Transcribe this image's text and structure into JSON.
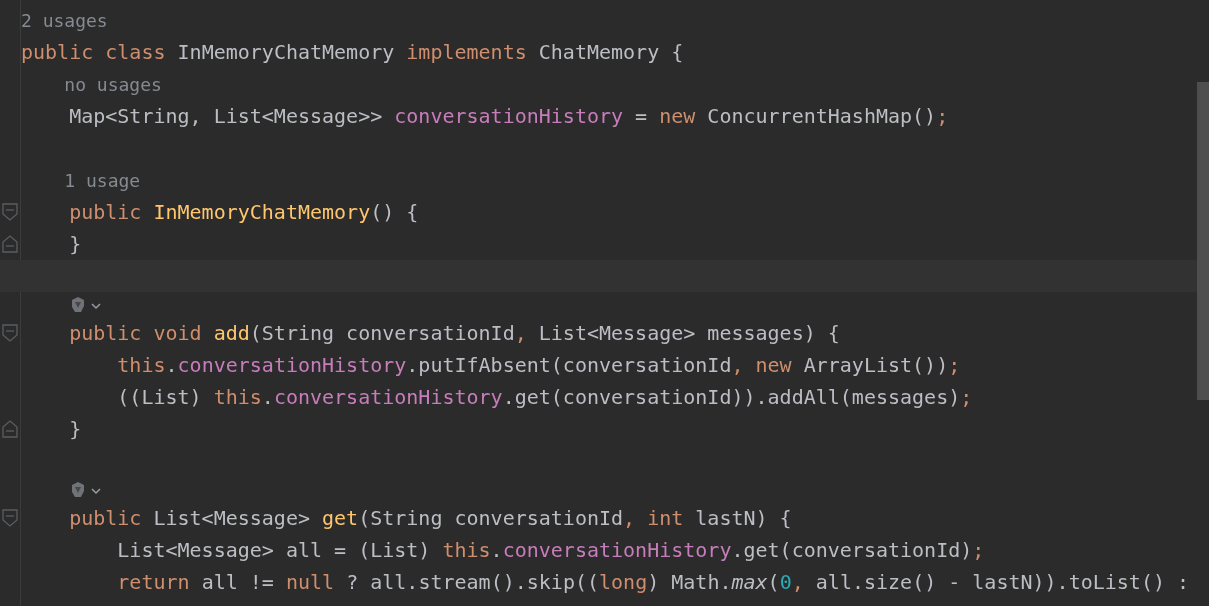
{
  "editor": {
    "lines": [
      {
        "kind": "hint",
        "tokens": [
          {
            "t": "2 usages",
            "kind": "hint"
          }
        ]
      },
      {
        "kind": "code",
        "tokens": [
          {
            "t": "public class ",
            "kind": "kw"
          },
          {
            "t": "InMemoryChatMemory ",
            "kind": "plain"
          },
          {
            "t": "implements ",
            "kind": "kw"
          },
          {
            "t": "ChatMemory {",
            "kind": "plain"
          }
        ]
      },
      {
        "kind": "hint",
        "tokens": [
          {
            "t": "    no usages",
            "kind": "hint"
          }
        ]
      },
      {
        "kind": "code",
        "tokens": [
          {
            "t": "    Map<String, List<Message>> ",
            "kind": "plain"
          },
          {
            "t": "conversationHistory",
            "kind": "field"
          },
          {
            "t": " = ",
            "kind": "plain"
          },
          {
            "t": "new ",
            "kind": "kw"
          },
          {
            "t": "ConcurrentHashMap()",
            "kind": "plain"
          },
          {
            "t": ";",
            "kind": "kw"
          }
        ]
      },
      {
        "kind": "blank"
      },
      {
        "kind": "hint",
        "tokens": [
          {
            "t": "    1 usage",
            "kind": "hint"
          }
        ]
      },
      {
        "kind": "code",
        "fold": {
          "kind": "start"
        },
        "tokens": [
          {
            "t": "    public ",
            "kind": "kw"
          },
          {
            "t": "InMemoryChatMemory",
            "kind": "decl"
          },
          {
            "t": "() {",
            "kind": "plain"
          }
        ]
      },
      {
        "kind": "code",
        "fold": {
          "kind": "end"
        },
        "tokens": [
          {
            "t": "    }",
            "kind": "plain"
          }
        ]
      },
      {
        "kind": "blank",
        "current": true
      },
      {
        "kind": "icon"
      },
      {
        "kind": "code",
        "fold": {
          "kind": "start"
        },
        "tokens": [
          {
            "t": "    public void ",
            "kind": "kw"
          },
          {
            "t": "add",
            "kind": "decl"
          },
          {
            "t": "(String conversationId",
            "kind": "plain"
          },
          {
            "t": ", ",
            "kind": "kw"
          },
          {
            "t": "List<Message> messages) {",
            "kind": "plain"
          }
        ]
      },
      {
        "kind": "code",
        "tokens": [
          {
            "t": "        this",
            "kind": "kw"
          },
          {
            "t": ".",
            "kind": "plain"
          },
          {
            "t": "conversationHistory",
            "kind": "field"
          },
          {
            "t": ".putIfAbsent(conversationId",
            "kind": "plain"
          },
          {
            "t": ", ",
            "kind": "kw"
          },
          {
            "t": "new ",
            "kind": "kw"
          },
          {
            "t": "ArrayList())",
            "kind": "plain"
          },
          {
            "t": ";",
            "kind": "kw"
          }
        ]
      },
      {
        "kind": "code",
        "tokens": [
          {
            "t": "        ((List) ",
            "kind": "plain"
          },
          {
            "t": "this",
            "kind": "kw"
          },
          {
            "t": ".",
            "kind": "plain"
          },
          {
            "t": "conversationHistory",
            "kind": "field"
          },
          {
            "t": ".get(conversationId)).addAll(messages)",
            "kind": "plain"
          },
          {
            "t": ";",
            "kind": "kw"
          }
        ]
      },
      {
        "kind": "code",
        "fold": {
          "kind": "end"
        },
        "tokens": [
          {
            "t": "    }",
            "kind": "plain"
          }
        ]
      },
      {
        "kind": "blank"
      },
      {
        "kind": "icon"
      },
      {
        "kind": "code",
        "fold": {
          "kind": "start"
        },
        "tokens": [
          {
            "t": "    public ",
            "kind": "kw"
          },
          {
            "t": "List<Message> ",
            "kind": "plain"
          },
          {
            "t": "get",
            "kind": "decl"
          },
          {
            "t": "(String conversationId",
            "kind": "plain"
          },
          {
            "t": ", ",
            "kind": "kw"
          },
          {
            "t": "int ",
            "kind": "kw"
          },
          {
            "t": "lastN) {",
            "kind": "plain"
          }
        ]
      },
      {
        "kind": "code",
        "tokens": [
          {
            "t": "        List<Message> all = (List) ",
            "kind": "plain"
          },
          {
            "t": "this",
            "kind": "kw"
          },
          {
            "t": ".",
            "kind": "plain"
          },
          {
            "t": "conversationHistory",
            "kind": "field"
          },
          {
            "t": ".get(conversationId)",
            "kind": "plain"
          },
          {
            "t": ";",
            "kind": "kw"
          }
        ]
      },
      {
        "kind": "code",
        "tokens": [
          {
            "t": "        return ",
            "kind": "kw"
          },
          {
            "t": "all != ",
            "kind": "plain"
          },
          {
            "t": "null ",
            "kind": "kw"
          },
          {
            "t": "? all.stream().skip((",
            "kind": "plain"
          },
          {
            "t": "long",
            "kind": "kw"
          },
          {
            "t": ") Math.",
            "kind": "plain"
          },
          {
            "t": "max",
            "kind": "italic"
          },
          {
            "t": "(",
            "kind": "plain"
          },
          {
            "t": "0",
            "kind": "num"
          },
          {
            "t": ", ",
            "kind": "kw"
          },
          {
            "t": "all.size() - lastN)).toList() :",
            "kind": "plain"
          }
        ]
      }
    ]
  }
}
